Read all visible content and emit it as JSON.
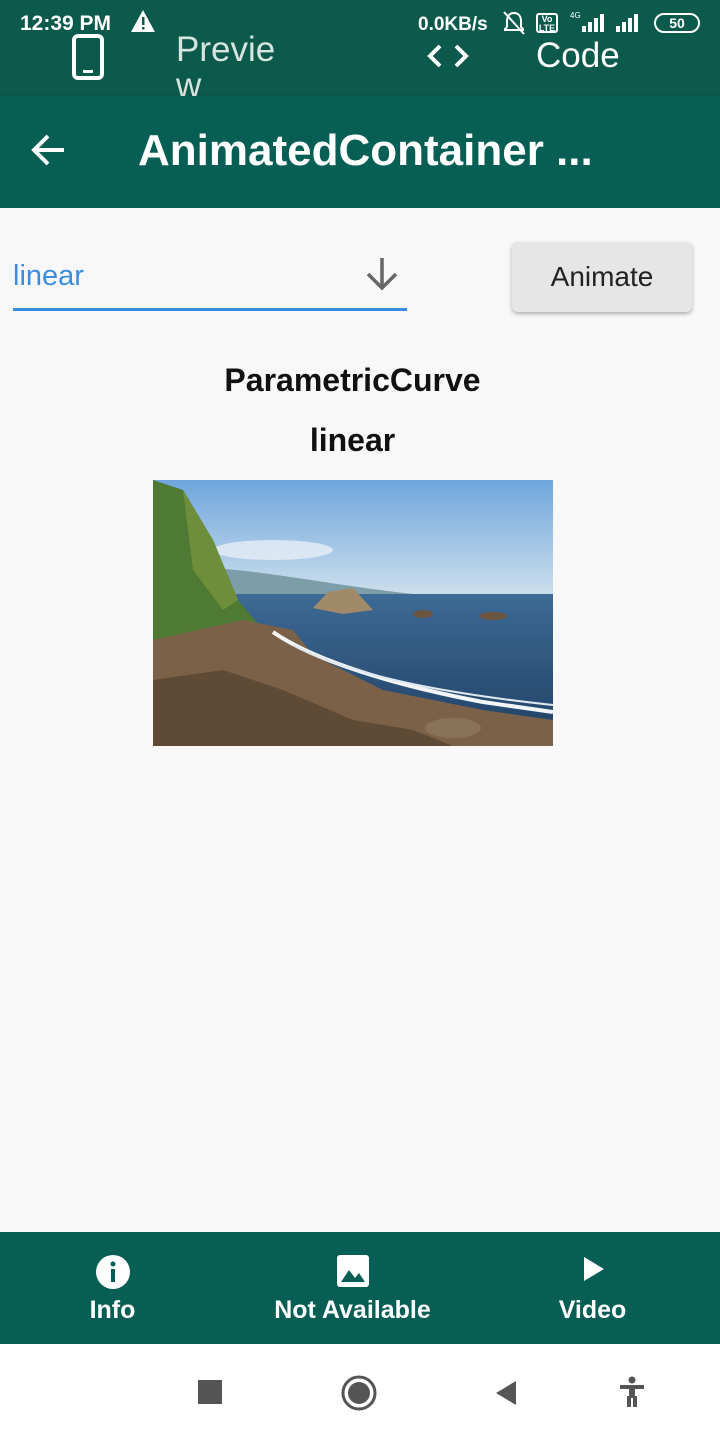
{
  "status": {
    "time": "12:39 PM",
    "speed": "0.0KB/s",
    "battery": "50"
  },
  "tabs": [
    {
      "label": "Previe\nw",
      "icon": "phone-icon"
    },
    {
      "label": "Code",
      "icon": "code-icon"
    }
  ],
  "appbar": {
    "title": "AnimatedContainer ..."
  },
  "controls": {
    "dropdown_value": "linear",
    "animate_label": "Animate"
  },
  "preview": {
    "line1": "ParametricCurve",
    "line2": "linear"
  },
  "bottom_nav": [
    {
      "label": "Info",
      "icon": "info-icon"
    },
    {
      "label": "Not Available",
      "icon": "image-icon"
    },
    {
      "label": "Video",
      "icon": "play-icon"
    }
  ],
  "colors": {
    "primary": "#075e54",
    "accent": "#3b8ddf"
  }
}
